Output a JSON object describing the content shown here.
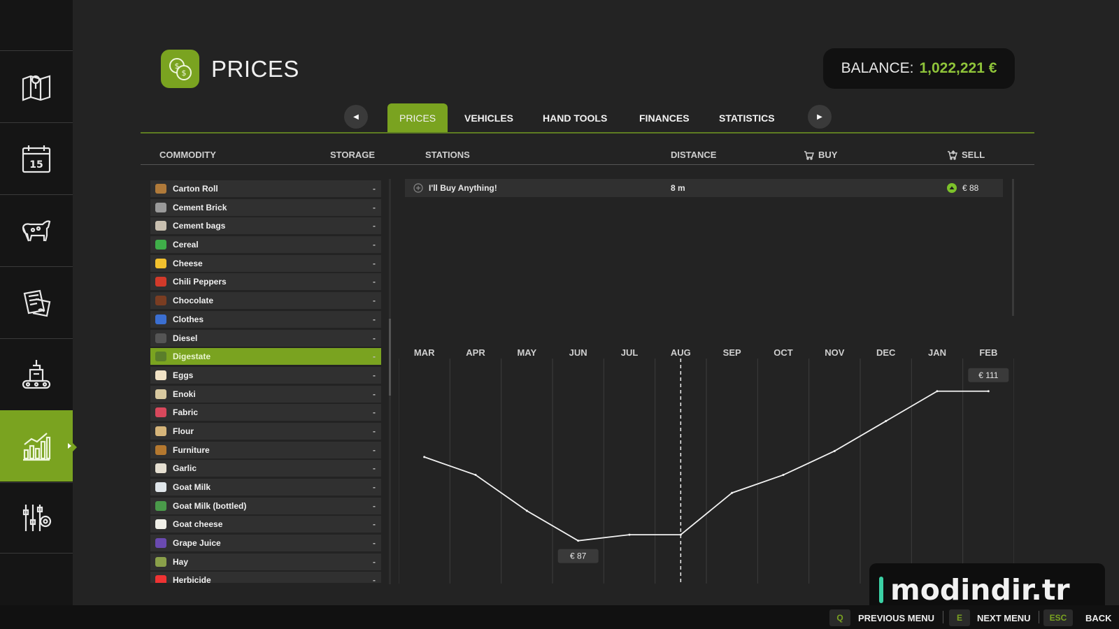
{
  "header": {
    "title": "PRICES",
    "balance_label": "BALANCE:",
    "balance_value": "1,022,221 €"
  },
  "tabs": [
    {
      "label": "PRICES",
      "active": true
    },
    {
      "label": "VEHICLES"
    },
    {
      "label": "HAND TOOLS"
    },
    {
      "label": "FINANCES"
    },
    {
      "label": "STATISTICS"
    }
  ],
  "columns": {
    "commodity": "COMMODITY",
    "storage": "STORAGE",
    "stations": "STATIONS",
    "distance": "DISTANCE",
    "buy": "BUY",
    "sell": "SELL"
  },
  "commodities": [
    {
      "name": "Carton Roll",
      "storage": "-",
      "icon": "carton-roll-icon",
      "color": "#b07a3a"
    },
    {
      "name": "Cement Brick",
      "storage": "-",
      "icon": "cement-brick-icon",
      "color": "#9a9a9a"
    },
    {
      "name": "Cement bags",
      "storage": "-",
      "icon": "cement-bags-icon",
      "color": "#c9c0b0"
    },
    {
      "name": "Cereal",
      "storage": "-",
      "icon": "cereal-icon",
      "color": "#3fae49"
    },
    {
      "name": "Cheese",
      "storage": "-",
      "icon": "cheese-icon",
      "color": "#f2c12e"
    },
    {
      "name": "Chili Peppers",
      "storage": "-",
      "icon": "chili-peppers-icon",
      "color": "#d23a2a"
    },
    {
      "name": "Chocolate",
      "storage": "-",
      "icon": "chocolate-icon",
      "color": "#7a3d22"
    },
    {
      "name": "Clothes",
      "storage": "-",
      "icon": "clothes-icon",
      "color": "#3b6fd1"
    },
    {
      "name": "Diesel",
      "storage": "-",
      "icon": "diesel-icon",
      "color": "#555555"
    },
    {
      "name": "Digestate",
      "storage": "-",
      "icon": "digestate-icon",
      "color": "#5a7e2a",
      "selected": true
    },
    {
      "name": "Eggs",
      "storage": "-",
      "icon": "eggs-icon",
      "color": "#f1e3c6"
    },
    {
      "name": "Enoki",
      "storage": "-",
      "icon": "enoki-icon",
      "color": "#d8c9a0"
    },
    {
      "name": "Fabric",
      "storage": "-",
      "icon": "fabric-icon",
      "color": "#d8485c"
    },
    {
      "name": "Flour",
      "storage": "-",
      "icon": "flour-icon",
      "color": "#d6b57a"
    },
    {
      "name": "Furniture",
      "storage": "-",
      "icon": "furniture-icon",
      "color": "#b4782f"
    },
    {
      "name": "Garlic",
      "storage": "-",
      "icon": "garlic-icon",
      "color": "#e6e0d2"
    },
    {
      "name": "Goat Milk",
      "storage": "-",
      "icon": "goat-milk-icon",
      "color": "#e0e6ea"
    },
    {
      "name": "Goat Milk (bottled)",
      "storage": "-",
      "icon": "goat-milk-bottled-icon",
      "color": "#4a9a4a"
    },
    {
      "name": "Goat cheese",
      "storage": "-",
      "icon": "goat-cheese-icon",
      "color": "#f0efe8"
    },
    {
      "name": "Grape Juice",
      "storage": "-",
      "icon": "grape-juice-icon",
      "color": "#6a4ab0"
    },
    {
      "name": "Hay",
      "storage": "-",
      "icon": "hay-icon",
      "color": "#8aa04a"
    },
    {
      "name": "Herbicide",
      "storage": "-",
      "icon": "herbicide-icon",
      "color": "#e33"
    }
  ],
  "stations": [
    {
      "name": "I'll Buy Anything!",
      "distance": "8 m",
      "sell_price": "€ 88",
      "trend": "up"
    }
  ],
  "chart_data": {
    "type": "line",
    "categories": [
      "MAR",
      "APR",
      "MAY",
      "JUN",
      "JUL",
      "AUG",
      "SEP",
      "OCT",
      "NOV",
      "DEC",
      "JAN",
      "FEB"
    ],
    "values": [
      100,
      97,
      91,
      86,
      87,
      87,
      94,
      97,
      101,
      106,
      111,
      111
    ],
    "current_month": "AUG",
    "min_label": "€ 87",
    "max_label": "€ 111",
    "ylim": [
      80,
      116
    ]
  },
  "footer": [
    {
      "key": "Q",
      "label": "PREVIOUS MENU"
    },
    {
      "key": "E",
      "label": "NEXT MENU"
    },
    {
      "key": "ESC",
      "label": "BACK"
    }
  ],
  "watermark": "modindir.tr",
  "colors": {
    "accent": "#7aa320",
    "balance": "#8fc43a"
  }
}
